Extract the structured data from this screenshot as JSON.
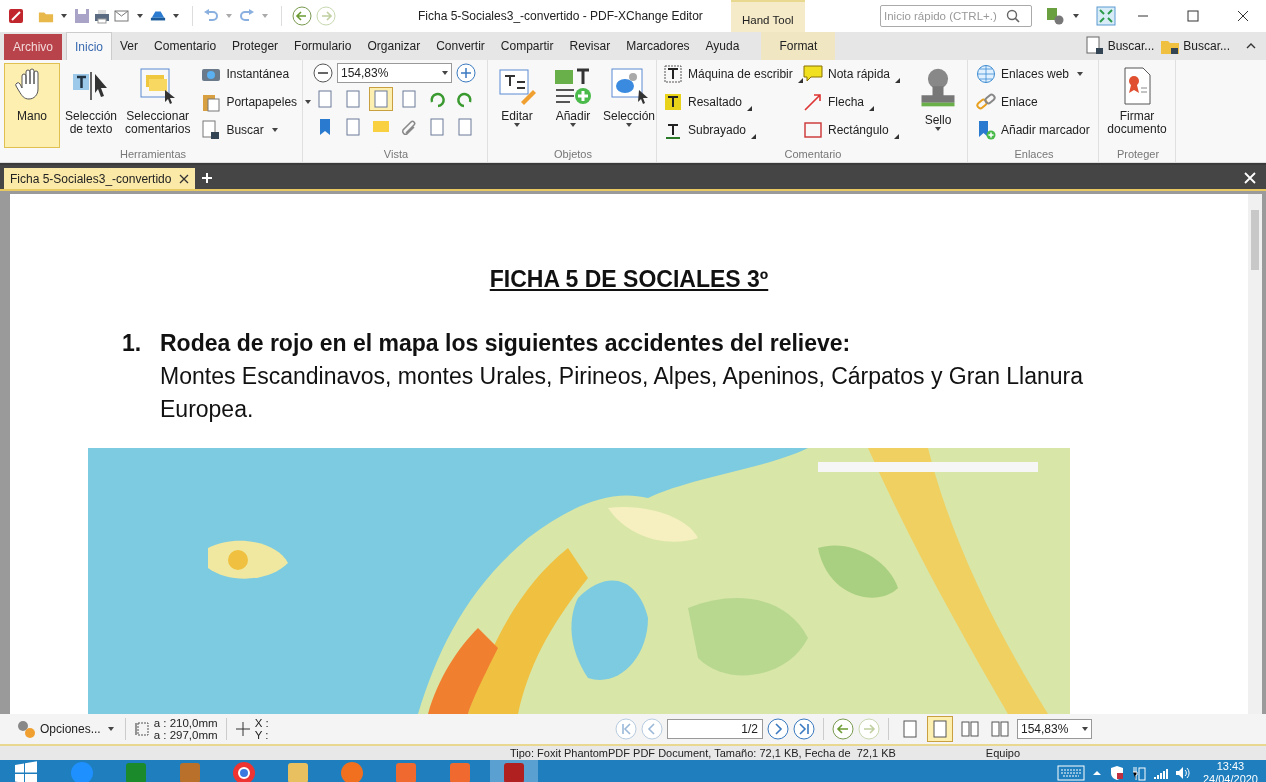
{
  "title_bar": {
    "title": "Ficha 5-Sociales3_-convertido - PDF-XChange Editor",
    "context_tab": "Hand Tool",
    "search": {
      "placeholder": "Inicio rápido (CTRL+.)"
    }
  },
  "menu": [
    {
      "label": "Archivo",
      "kind": "file",
      "selected": false
    },
    {
      "label": "Inicio",
      "kind": "tab",
      "selected": true
    },
    {
      "label": "Ver",
      "kind": "tab",
      "selected": false
    },
    {
      "label": "Comentario",
      "kind": "tab",
      "selected": false
    },
    {
      "label": "Proteger",
      "kind": "tab",
      "selected": false
    },
    {
      "label": "Formulario",
      "kind": "tab",
      "selected": false
    },
    {
      "label": "Organizar",
      "kind": "tab",
      "selected": false
    },
    {
      "label": "Convertir",
      "kind": "tab",
      "selected": false
    },
    {
      "label": "Compartir",
      "kind": "tab",
      "selected": false
    },
    {
      "label": "Revisar",
      "kind": "tab",
      "selected": false
    },
    {
      "label": "Marcadores",
      "kind": "tab",
      "selected": false
    },
    {
      "label": "Ayuda",
      "kind": "tab",
      "selected": false
    },
    {
      "label": "Format",
      "kind": "context",
      "selected": false
    }
  ],
  "menu_right": [
    "Buscar...",
    "Buscar..."
  ],
  "ribbon": [
    {
      "label": "Herramientas",
      "kind": "tools",
      "large": [
        {
          "label": "Mano",
          "selected": true
        },
        {
          "label": "Selección de texto",
          "selected": false
        },
        {
          "label": "Seleccionar comentarios",
          "selected": false
        }
      ],
      "small": [
        {
          "label": "Instantánea",
          "dropdown": false
        },
        {
          "label": "Portapapeles",
          "dropdown": true
        },
        {
          "label": "Buscar",
          "dropdown": true
        }
      ]
    },
    {
      "label": "Vista",
      "kind": "view",
      "zoom": "154,83%",
      "buttons": [
        {
          "selected": false
        },
        {
          "selected": false
        },
        {
          "selected": true
        },
        {
          "selected": false
        },
        {
          "selected": false
        },
        {
          "selected": false
        },
        {
          "selected": false
        },
        {
          "selected": false
        },
        {
          "selected": false
        },
        {
          "selected": false
        },
        {
          "selected": false
        },
        {
          "selected": false
        }
      ]
    },
    {
      "label": "Objetos",
      "kind": "objects",
      "large": [
        {
          "label": "Editar",
          "selected": false
        },
        {
          "label": "Añadir",
          "selected": false
        },
        {
          "label": "Selección",
          "selected": false
        }
      ]
    },
    {
      "label": "Comentario",
      "kind": "comments",
      "small": [
        {
          "label": "Máquina de escribir",
          "dropdown": true
        },
        {
          "label": "Resaltado",
          "dropdown": true
        },
        {
          "label": "Subrayado",
          "dropdown": true
        },
        {
          "label": "Nota rápida",
          "dropdown": true
        },
        {
          "label": "Flecha",
          "dropdown": true
        },
        {
          "label": "Rectángulo",
          "dropdown": true
        }
      ],
      "large": [
        {
          "label": "Sello",
          "selected": false
        }
      ]
    },
    {
      "label": "Enlaces",
      "kind": "links",
      "small": [
        {
          "label": "Enlaces web",
          "dropdown": true
        },
        {
          "label": "Enlace",
          "dropdown": false
        },
        {
          "label": "Añadir marcador",
          "dropdown": false
        }
      ]
    },
    {
      "label": "Proteger",
      "kind": "protect",
      "large": [
        {
          "label": "Firmar documento",
          "selected": false
        }
      ]
    }
  ],
  "doc_tabs": [
    {
      "label": "Ficha 5-Sociales3_-convertido",
      "selected": true
    }
  ],
  "document": {
    "heading": "FICHA 5 DE SOCIALES 3º",
    "number": "1.",
    "question": "Rodea de rojo en el mapa los siguientes accidentes del relieve:",
    "body": "Montes Escandinavos, montes Urales, Pirineos, Alpes, Apeninos, Cárpatos y Gran Llanura Europea."
  },
  "status_bar": {
    "options": "Opciones...",
    "width": "a : 210,0mm",
    "height": "a : 297,0mm",
    "x": "X :",
    "y": "Y :",
    "page": "1/2",
    "zoom": "154,83%",
    "layouts": [
      {
        "selected": false
      },
      {
        "selected": true
      },
      {
        "selected": false
      },
      {
        "selected": false
      }
    ]
  },
  "tooltip": {
    "type": "Tipo: Foxit PhantomPDF PDF Document, Tamaño: 72,1 KB, Fecha de",
    "size": "72,1 KB",
    "location": "Equipo"
  },
  "taskbar": {
    "apps": [
      {
        "selected": false
      },
      {
        "selected": false
      },
      {
        "selected": false
      },
      {
        "selected": false
      },
      {
        "selected": false
      },
      {
        "selected": false
      },
      {
        "selected": false
      },
      {
        "selected": false
      },
      {
        "selected": true
      }
    ],
    "time": "13:43",
    "date": "24/04/2020"
  }
}
